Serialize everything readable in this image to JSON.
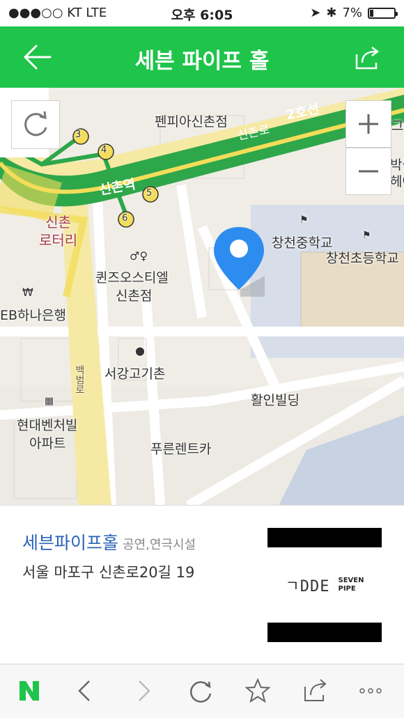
{
  "status": {
    "carrier": "●●●○○ KT   LTE",
    "time": "오후 6:05",
    "battery": "7%"
  },
  "header": {
    "title": "세븐 파이프 홀"
  },
  "map": {
    "labels": {
      "penfia": "펜피아신촌점",
      "line2": "2호선",
      "sinchonro": "신촌로",
      "station": "신촌역",
      "rotary_1": "신촌",
      "rotary_2": "로터리",
      "changcheon_middle": "창천중학교",
      "changcheon_elem": "창천초등학교",
      "queens_1": "퀸즈오스티엘",
      "queens_2": "신촌점",
      "hana": "EB하나은행",
      "seogang": "서강고기촌",
      "baekbeom": "백범로",
      "hwalin": "활인빌딩",
      "hyundai_1": "현대벤처빌",
      "hyundai_2": "아파트",
      "pureun": "푸른렌트카",
      "exit3": "3",
      "exit4": "4",
      "exit5": "5",
      "exit6": "6",
      "edge_right_1": "그",
      "edge_right_2": "박물",
      "edge_right_3": "헤어"
    }
  },
  "place": {
    "name": "세븐파이프홀",
    "category": "공연,연극시설",
    "address": "서울 마포구 신촌로20길 19",
    "logo_text": "ㄱDDE",
    "brand_line1": "SEVEN",
    "brand_line2": "PIPE"
  },
  "colors": {
    "accent": "#1fc44b",
    "link": "#2a63b9"
  }
}
